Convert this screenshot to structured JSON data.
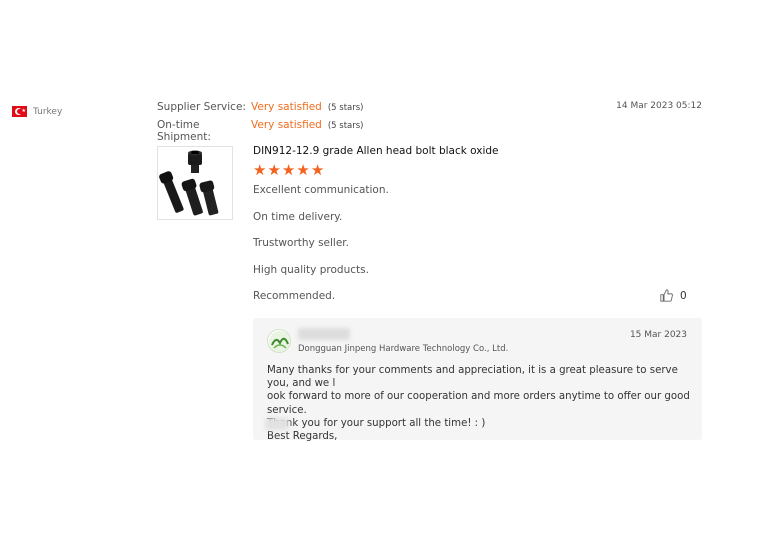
{
  "reviewer": {
    "country": "Turkey",
    "flag_icon": "turkey-flag-icon"
  },
  "ratings": [
    {
      "label": "Supplier Service:",
      "value": "Very satisfied",
      "stars_text": "(5 stars)"
    },
    {
      "label": "On-time Shipment:",
      "value": "Very satisfied",
      "stars_text": "(5 stars)"
    }
  ],
  "review": {
    "date": "14 Mar 2023 05:12",
    "product_title": "DIN912-12.9 grade Allen head bolt black oxide",
    "rating": 5,
    "lines": [
      "Excellent communication.",
      "On time delivery.",
      "Trustworthy seller.",
      "High quality products.",
      "Recommended."
    ],
    "like_count": "0"
  },
  "reply": {
    "company": "Dongguan Jinpeng Hardware Technology Co., Ltd.",
    "date": "15 Mar 2023",
    "lines": [
      "Many thanks for your comments and appreciation, it is a great pleasure to serve you, and we l",
      "ook forward to more of our cooperation and more orders anytime to offer our good service.",
      "Thank you for your support all the time!  : )",
      "Best Regards,"
    ]
  },
  "colors": {
    "accent": "#ef6c1d",
    "star": "#f5621f",
    "reply_bg": "#f5f5f5"
  }
}
